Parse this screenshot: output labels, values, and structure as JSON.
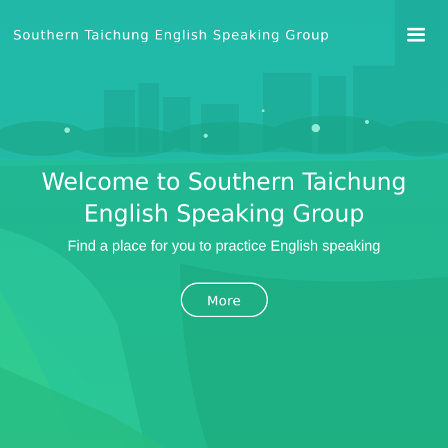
{
  "navbar": {
    "brand": "Southern Taichung English Speaking Group",
    "menu_icon": "hamburger-menu-icon"
  },
  "hero": {
    "title": "Welcome to Southern Taichung English Speaking Group",
    "subtitle": "Find a place for you to practice English speaking",
    "button_label": "More"
  },
  "colors": {
    "overlay_top": "#1fb9a6",
    "overlay_bottom": "#27c28a",
    "text": "#ffffff"
  }
}
